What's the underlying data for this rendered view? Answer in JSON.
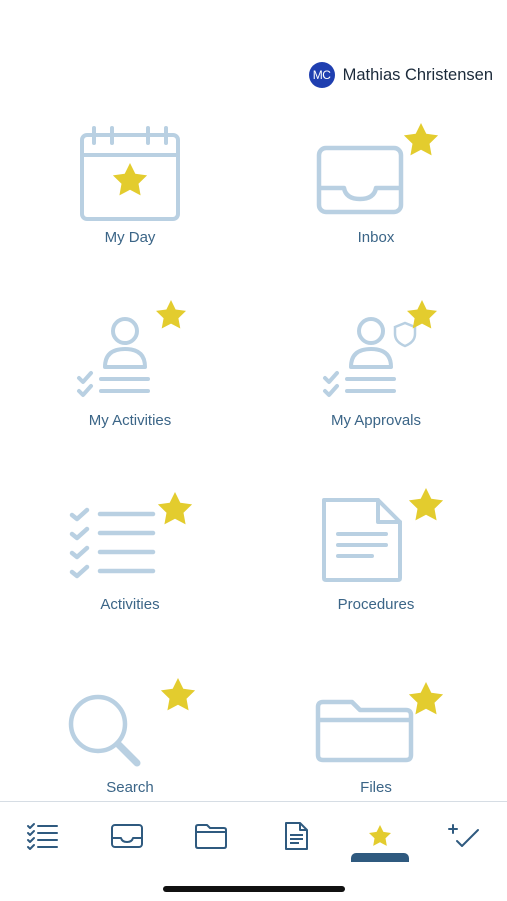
{
  "user": {
    "initials": "MC",
    "name": "Mathias Christensen"
  },
  "tiles": [
    {
      "label": "My Day",
      "icon": "calendar-star-icon",
      "favorite": true
    },
    {
      "label": "Inbox",
      "icon": "inbox-tray-icon",
      "favorite": true
    },
    {
      "label": "My Activities",
      "icon": "user-checklist-icon",
      "favorite": true
    },
    {
      "label": "My Approvals",
      "icon": "user-checklist-shield-icon",
      "favorite": true
    },
    {
      "label": "Activities",
      "icon": "checklist-icon",
      "favorite": true
    },
    {
      "label": "Procedures",
      "icon": "document-icon",
      "favorite": true
    },
    {
      "label": "Search",
      "icon": "magnifier-icon",
      "favorite": true
    },
    {
      "label": "Files",
      "icon": "folder-icon",
      "favorite": true
    }
  ],
  "tab_bar": {
    "tabs": [
      {
        "icon": "checklist-icon"
      },
      {
        "icon": "inbox-tray-icon"
      },
      {
        "icon": "folder-icon"
      },
      {
        "icon": "document-icon"
      },
      {
        "icon": "star-icon",
        "active": true
      },
      {
        "icon": "add-check-icon"
      }
    ]
  },
  "colors": {
    "icon_light": "#b9d0e2",
    "icon_dark": "#2f5a7f",
    "star": "#e3cc2e",
    "label": "#3b6587",
    "avatar": "#1f3fb0"
  }
}
